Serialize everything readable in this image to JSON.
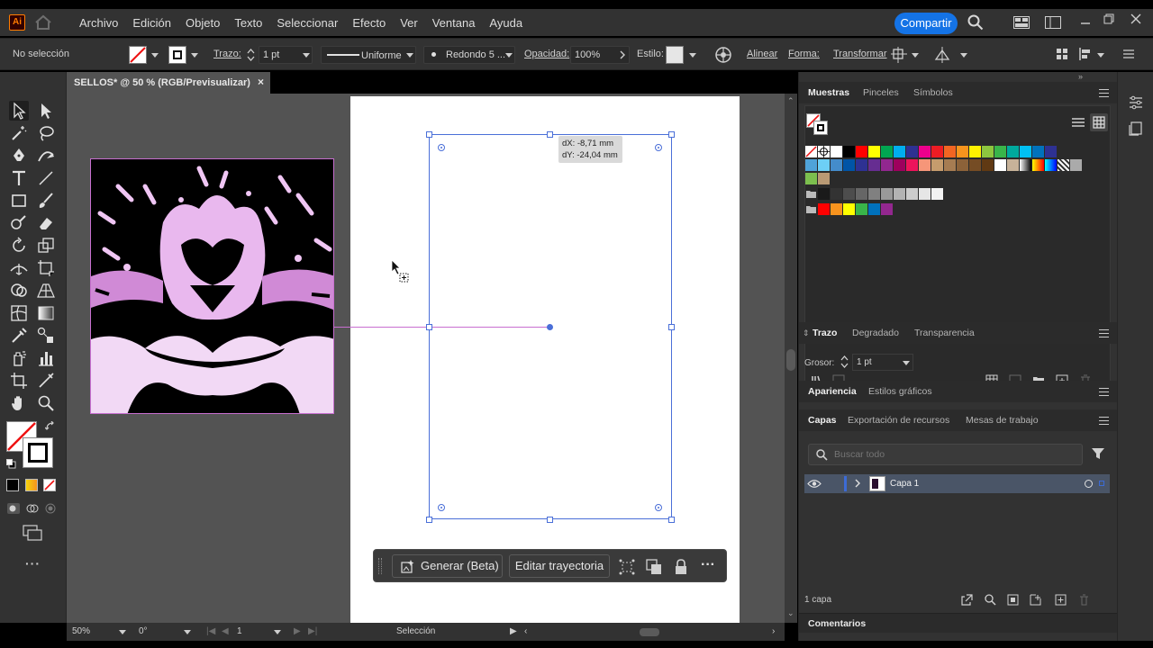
{
  "app": {
    "logo": "Ai"
  },
  "menu": {
    "items": [
      "Archivo",
      "Edición",
      "Objeto",
      "Texto",
      "Seleccionar",
      "Efecto",
      "Ver",
      "Ventana",
      "Ayuda"
    ],
    "share_label": "Compartir"
  },
  "control": {
    "selection": "No selección",
    "trazo_label": "Trazo:",
    "trazo_value": "1 pt",
    "profile": "Uniforme",
    "brush": "Redondo 5 ...",
    "opacity_label": "Opacidad:",
    "opacity_value": "100%",
    "style_label": "Estilo:",
    "align": "Alinear",
    "shape": "Forma:",
    "transform": "Transformar"
  },
  "document": {
    "tab_title": "SELLOS* @ 50 % (RGB/Previsualizar)",
    "close_glyph": "×"
  },
  "canvas": {
    "tooltip_dx": "dX: -8,71 mm",
    "tooltip_dy": "dY: -24,04 mm"
  },
  "context_bar": {
    "generate": "Generar (Beta)",
    "edit_path": "Editar trayectoria"
  },
  "status": {
    "zoom": "50%",
    "rotation": "0°",
    "artboard": "1",
    "mode": "Selección"
  },
  "panels": {
    "swatches_tabs": [
      "Muestras",
      "Pinceles",
      "Símbolos"
    ],
    "stroke_tabs": [
      "Trazo",
      "Degradado",
      "Transparencia"
    ],
    "stroke_weight_label": "Grosor:",
    "stroke_weight_value": "1 pt",
    "appearance_tabs": [
      "Apariencia",
      "Estilos gráficos"
    ],
    "layers_tabs": [
      "Capas",
      "Exportación de recursos",
      "Mesas de trabajo"
    ],
    "search_placeholder": "Buscar todo",
    "layer_name": "Capa 1",
    "layer_count": "1 capa",
    "comments": "Comentarios"
  },
  "colors": {
    "accent_blue": "#1473e6",
    "selection_blue": "#4a6fd8",
    "artwork_magenta": "#e27ae6",
    "swatch_row1": [
      "#ffffff",
      "#000000",
      "#ff0000",
      "#ffff00",
      "#00a651",
      "#00aeef",
      "#2e3192",
      "#ec008c",
      "#ed1c24",
      "#f26522",
      "#f7941d",
      "#fff200",
      "#8dc63f",
      "#39b54a",
      "#00a99d",
      "#00bff3",
      "#0072bc",
      "#2e3192"
    ],
    "swatch_row2": [
      "#6dcff6",
      "#448ccb",
      "#0054a6",
      "#2e3192",
      "#662d91",
      "#92278f",
      "#9e005d",
      "#ed145b",
      "#f69679",
      "#c69c6d",
      "#a67c52",
      "#8c6239",
      "#754c24",
      "#603913",
      "#ffffff",
      "#c7b299"
    ],
    "swatch_gray": [
      "#1a1a1a",
      "#333333",
      "#4d4d4d",
      "#666666",
      "#808080",
      "#999999",
      "#b3b3b3",
      "#cccccc",
      "#e6e6e6",
      "#f2f2f2"
    ],
    "swatch_bright": [
      "#ff0000",
      "#f7931e",
      "#ffff00",
      "#39b54a",
      "#0071bc",
      "#93278f"
    ]
  }
}
